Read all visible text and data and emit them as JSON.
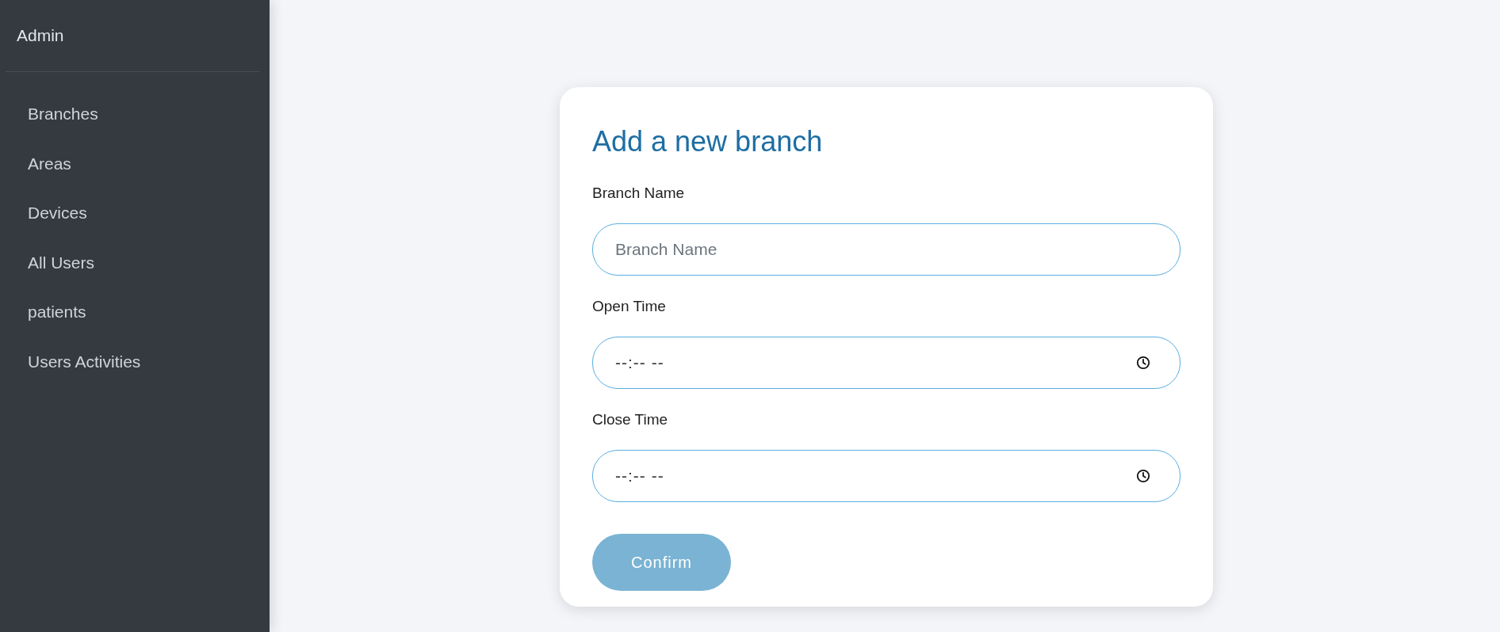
{
  "sidebar": {
    "title": "Admin",
    "items": [
      {
        "label": "Branches",
        "selected": false
      },
      {
        "label": "Areas",
        "selected": false
      },
      {
        "label": "Devices",
        "selected": false
      },
      {
        "label": "All Users",
        "selected": false
      },
      {
        "label": "patients",
        "selected": false
      },
      {
        "label": "Users Activities",
        "selected": false
      }
    ]
  },
  "form": {
    "title": "Add a new branch",
    "fields": [
      {
        "label": "Branch Name",
        "kind": "text",
        "placeholder": "Branch Name"
      },
      {
        "label": "Open Time",
        "kind": "time",
        "placeholder": "--:-- --"
      },
      {
        "label": "Close Time",
        "kind": "time",
        "placeholder": "--:-- --"
      }
    ],
    "button": "Confirm"
  }
}
